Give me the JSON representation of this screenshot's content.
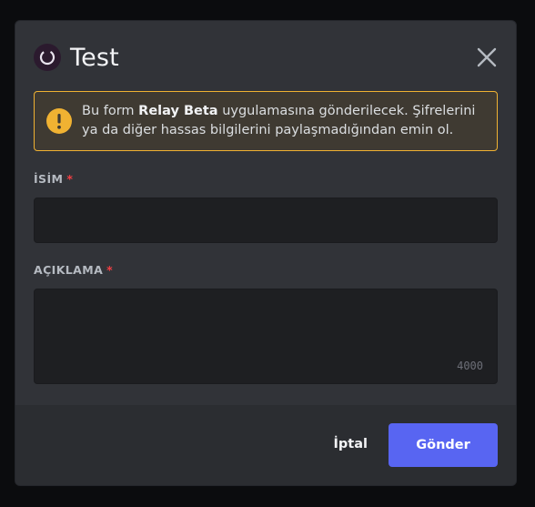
{
  "modal": {
    "title": "Test",
    "app_icon": "relay-app-icon",
    "close_icon": "close-icon"
  },
  "warning": {
    "icon": "warning-icon",
    "text_before": "Bu form ",
    "app_name": "Relay Beta",
    "text_after": " uygulamasına gönderilecek. Şifrelerini ya da diğer hassas bilgilerini paylaşmadığından emin ol."
  },
  "fields": {
    "name": {
      "label": "İSİM",
      "required_marker": "*",
      "value": ""
    },
    "description": {
      "label": "AÇIKLAMA",
      "required_marker": "*",
      "value": "",
      "char_limit": "4000"
    }
  },
  "footer": {
    "cancel_label": "İptal",
    "submit_label": "Gönder"
  },
  "colors": {
    "accent": "#5865f2",
    "warning": "#f0b232",
    "required": "#f23f43"
  }
}
